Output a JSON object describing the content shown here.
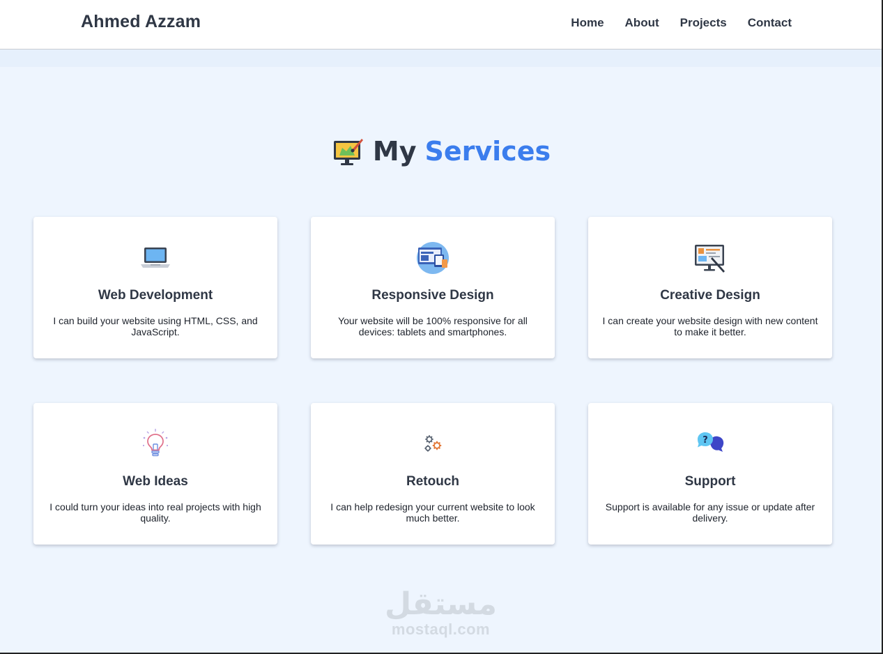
{
  "header": {
    "brand": "Ahmed Azzam",
    "nav": [
      "Home",
      "About",
      "Projects",
      "Contact"
    ]
  },
  "section": {
    "title_main": "My",
    "title_accent": "Services",
    "icon": "monitor-paint-icon"
  },
  "services": [
    {
      "title": "Web Development",
      "desc": "I can build your website using HTML, CSS, and JavaScript.",
      "icon": "laptop-icon"
    },
    {
      "title": "Responsive Design",
      "desc": "Your website will be 100% responsive for all devices: tablets and smartphones.",
      "icon": "responsive-devices-icon"
    },
    {
      "title": "Creative Design",
      "desc": "I can create your website design with new content to make it better.",
      "icon": "design-board-icon"
    },
    {
      "title": "Web Ideas",
      "desc": "I could turn your ideas into real projects with high quality.",
      "icon": "lightbulb-icon"
    },
    {
      "title": "Retouch",
      "desc": "I can help redesign your current website to look much better.",
      "icon": "gears-icon"
    },
    {
      "title": "Support",
      "desc": "Support is available for any issue or update after delivery.",
      "icon": "chat-support-icon"
    }
  ],
  "watermark": {
    "arabic": "مستقل",
    "latin": "mostaql.com"
  },
  "colors": {
    "accent": "#3b7ded",
    "text": "#2f3745",
    "background": "#eef5fe"
  }
}
